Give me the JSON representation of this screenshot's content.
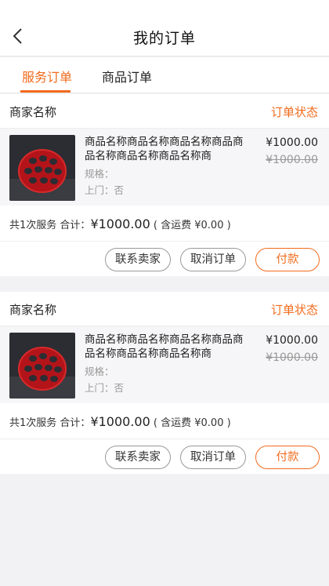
{
  "header": {
    "title": "我的订单",
    "back_icon": "chevron-left-icon"
  },
  "tabs": [
    {
      "label": "服务订单",
      "active": true
    },
    {
      "label": "商品订单",
      "active": false
    }
  ],
  "colors": {
    "accent": "#f26b1d",
    "background": "#f2f2f4"
  },
  "orders": [
    {
      "merchant": "商家名称",
      "status": "订单状态",
      "product": {
        "name": "商品名称商品名称商品名称商品商品名称商品名称商品名称商",
        "spec": "规格：",
        "visit": "上门：否",
        "price": "¥1000.00",
        "original_price": "¥1000.00"
      },
      "summary": {
        "count": "共1次服务",
        "total_label": "合计：",
        "total": "¥1000.00",
        "shipping": "( 含运费 ¥0.00 )"
      },
      "actions": {
        "contact": "联系卖家",
        "cancel": "取消订单",
        "pay": "付款"
      }
    },
    {
      "merchant": "商家名称",
      "status": "订单状态",
      "product": {
        "name": "商品名称商品名称商品名称商品商品名称商品名称商品名称商",
        "spec": "规格：",
        "visit": "上门：否",
        "price": "¥1000.00",
        "original_price": "¥1000.00"
      },
      "summary": {
        "count": "共1次服务",
        "total_label": "合计：",
        "total": "¥1000.00",
        "shipping": "( 含运费 ¥0.00 )"
      },
      "actions": {
        "contact": "联系卖家",
        "cancel": "取消订单",
        "pay": "付款"
      }
    }
  ]
}
